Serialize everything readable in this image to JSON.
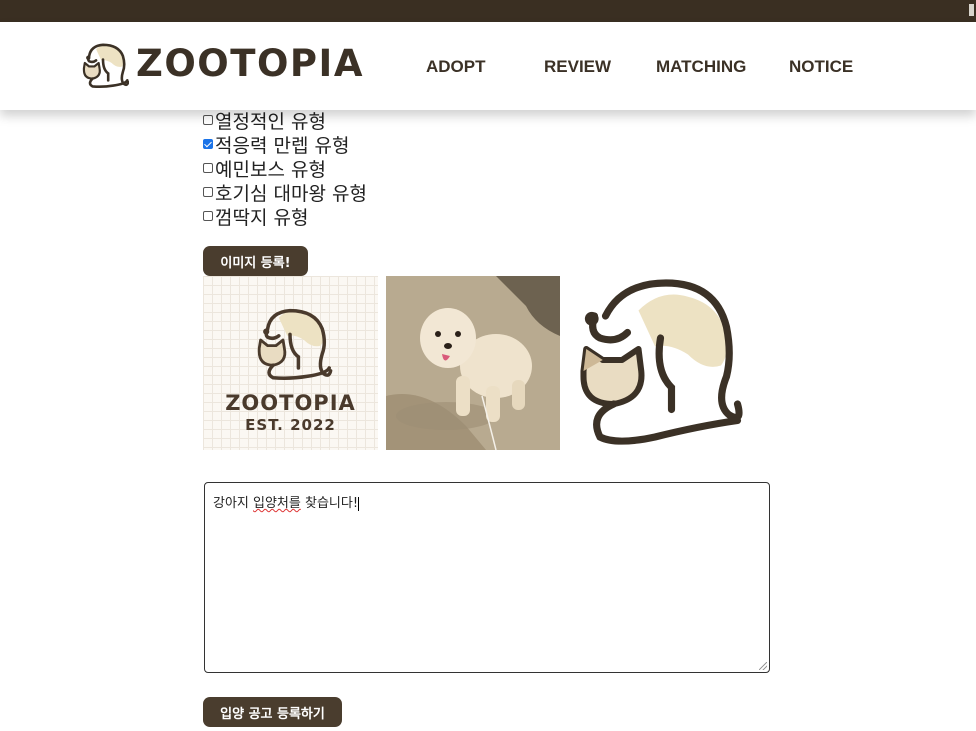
{
  "header": {
    "logo_text": "ZOOTOPIA",
    "nav": [
      {
        "label": "ADOPT"
      },
      {
        "label": "REVIEW"
      },
      {
        "label": "MATCHING"
      },
      {
        "label": "NOTICE"
      }
    ]
  },
  "personality_options": [
    {
      "label": "열정적인 유형",
      "checked": false
    },
    {
      "label": "적응력 만렙 유형",
      "checked": true
    },
    {
      "label": "예민보스 유형",
      "checked": false
    },
    {
      "label": "호기심 대마왕 유형",
      "checked": false
    },
    {
      "label": "껌딱지 유형",
      "checked": false
    }
  ],
  "image_button_label": "이미지 등록!",
  "thumbnails": {
    "logo_card_title": "ZOOTOPIA",
    "logo_card_subtitle": "EST. 2022"
  },
  "description": {
    "prefix": "강아지 ",
    "misspelled": "입양처를",
    "suffix": " 찾습니다!"
  },
  "submit_button_label": "입양 공고 등록하기",
  "colors": {
    "brand_dark": "#3b3126",
    "button_bg": "#4a3d2e",
    "checkbox_checked": "#1a73e8",
    "logo_cream": "#ede2c3"
  }
}
